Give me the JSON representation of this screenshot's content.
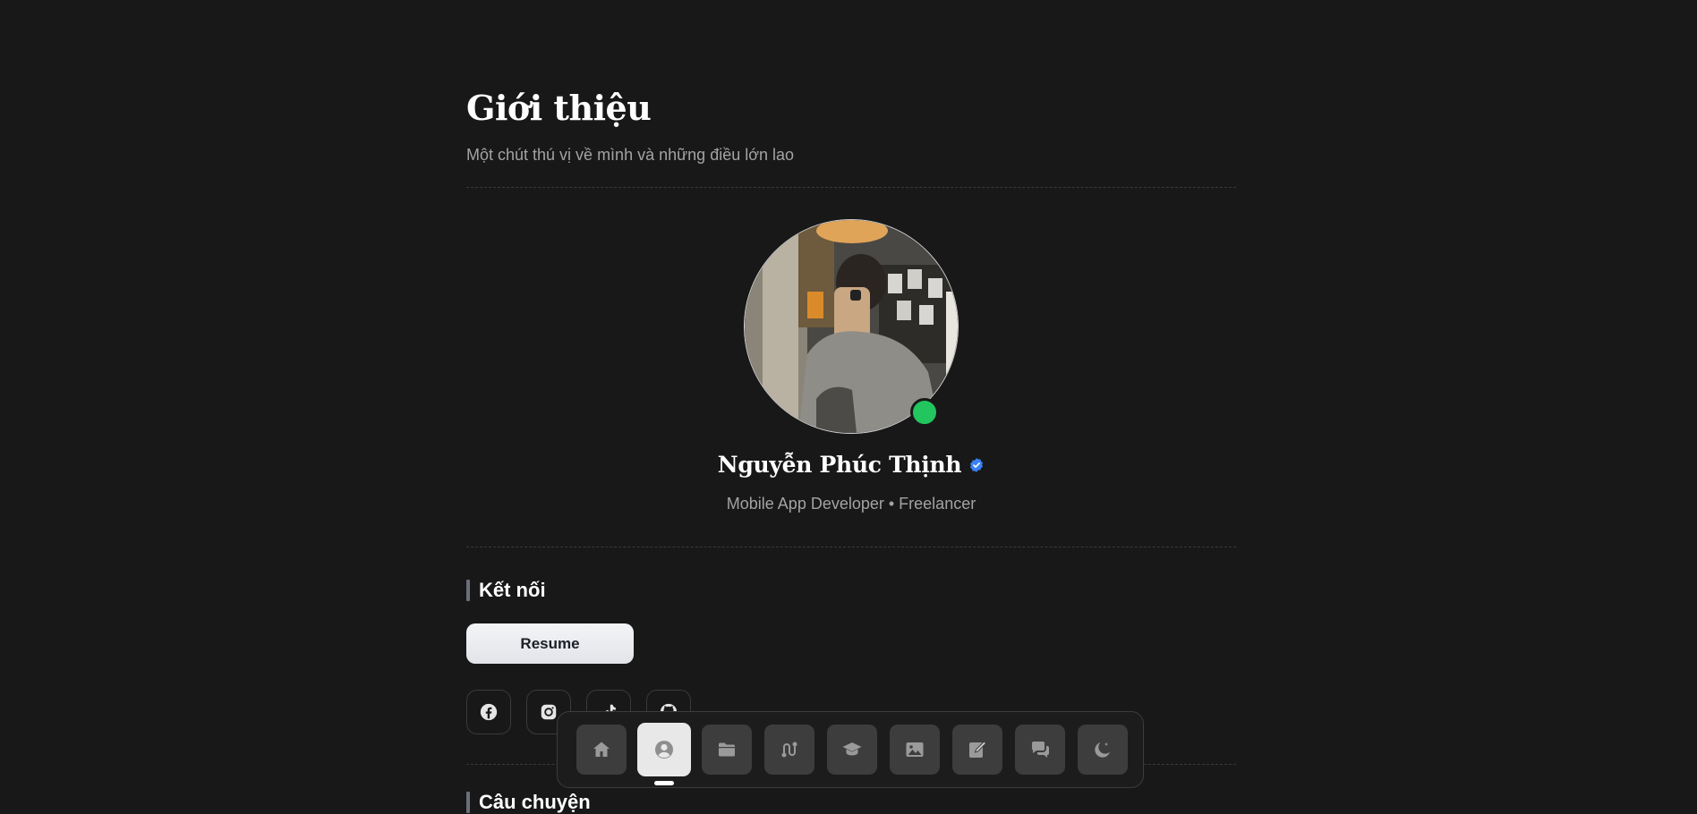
{
  "header": {
    "title": "Giới thiệu",
    "subtitle": "Một chút thú vị về mình và những điều lớn lao"
  },
  "profile": {
    "name": "Nguyễn Phúc Thịnh",
    "role": "Mobile App Developer • Freelancer",
    "online": true,
    "verified": true,
    "colors": {
      "online": "#22c55e",
      "verified": "#3b82f6"
    }
  },
  "connect": {
    "heading": "Kết nối",
    "resume_label": "Resume",
    "socials": [
      "facebook-icon",
      "instagram-icon",
      "tiktok-icon",
      "github-icon"
    ]
  },
  "story": {
    "heading": "Câu chuyện"
  },
  "dock": {
    "items": [
      "home-icon",
      "user-icon",
      "folder-icon",
      "route-icon",
      "graduation-cap-icon",
      "image-icon",
      "edit-icon",
      "chat-icon",
      "moon-icon"
    ],
    "active_index": 1
  }
}
